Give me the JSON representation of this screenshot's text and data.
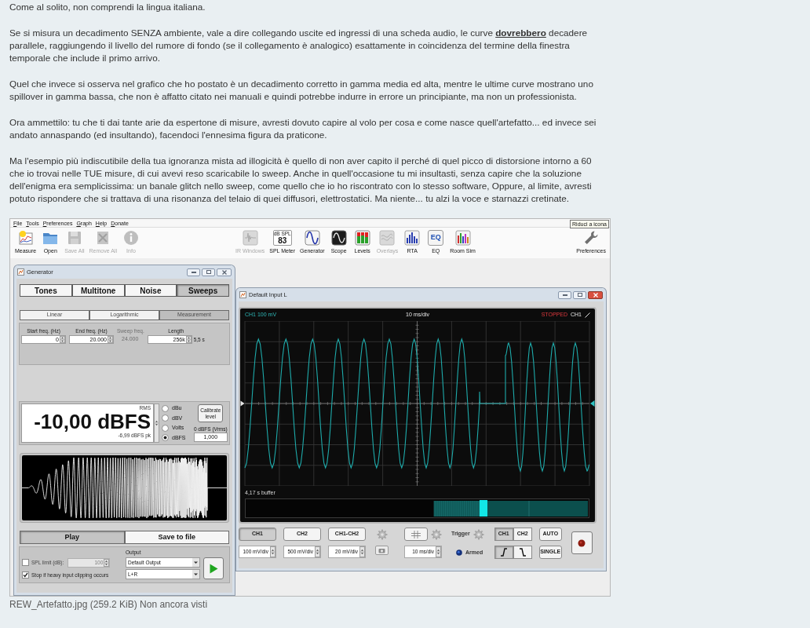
{
  "post": {
    "paragraphs": [
      "Come al solito, non comprendi la lingua italiana.",
      "Se si misura un decadimento SENZA ambiente, vale a dire collegando uscite ed ingressi di una scheda audio, le curve **dovrebbero** decadere parallele, raggiungendo il livello del rumore di fondo (se il collegamento è analogico) esattamente in coincidenza del termine della finestra temporale che include il primo arrivo.",
      "Quel che invece si osserva nel grafico che ho postato è un decadimento corretto in gamma media ed alta, mentre le ultime curve mostrano uno spillover in gamma bassa, che non è affatto citato nei manuali e quindi potrebbe indurre in errore un principiante, ma non un professionista.",
      "Ora ammettilo: tu che ti dai tante arie da espertone di misure, avresti dovuto capire al volo per cosa e come nasce quell'artefatto... ed invece sei andato annaspando (ed insultando), facendoci l'ennesima figura da praticone.",
      "Ma l'esempio più indiscutibile della tua ignoranza mista ad illogicità è quello di non aver capito il perché di quel picco di distorsione intorno a 60 che io trovai nelle TUE misure, di cui avevi reso scaricabile lo sweep. Anche in quell'occasione tu mi insultasti, senza capire che la soluzione dell'enigma era semplicissima: un banale glitch nello sweep, come quello che io ho riscontrato con lo stesso software, Oppure, al limite, avresti potuto rispondere che si trattava di una risonanza del telaio di quei diffusori, elettrostatici. Ma niente... tu alzi la voce e starnazzi cretinate."
    ]
  },
  "attachment": {
    "screenshot": {
      "menu": [
        "File",
        "Tools",
        "Preferences",
        "Graph",
        "Help",
        "Donate"
      ],
      "tooltip": "Riduci a icona",
      "toolbar": {
        "left": [
          {
            "label": "Measure",
            "kind": "measure",
            "disabled": false
          },
          {
            "label": "Open",
            "kind": "open",
            "disabled": false
          },
          {
            "label": "Save All",
            "kind": "save",
            "disabled": true
          },
          {
            "label": "Remove All",
            "kind": "remove",
            "disabled": true
          },
          {
            "label": "Info",
            "kind": "info",
            "disabled": true
          }
        ],
        "center": [
          {
            "label": "IR Windows",
            "kind": "impulse",
            "disabled": true
          },
          {
            "label": "SPL Meter",
            "kind": "meter",
            "disabled": false,
            "unit": "dB SPL",
            "reading": "83"
          },
          {
            "label": "Generator",
            "kind": "generator",
            "disabled": false
          },
          {
            "label": "Scope",
            "kind": "scope",
            "disabled": false
          },
          {
            "label": "Levels",
            "kind": "levels",
            "disabled": false
          },
          {
            "label": "Overlays",
            "kind": "overlays",
            "disabled": true
          },
          {
            "label": "RTA",
            "kind": "rta",
            "disabled": false
          },
          {
            "label": "EQ",
            "kind": "eq",
            "disabled": false,
            "mark": "EQ"
          },
          {
            "label": "Room Sim",
            "kind": "roomsim",
            "disabled": false
          }
        ],
        "right": [
          {
            "label": "Preferences",
            "kind": "preferences",
            "disabled": false
          }
        ]
      },
      "generator": {
        "title": "Generator",
        "active": false,
        "tabs": [
          {
            "label": "Tones",
            "selected": false
          },
          {
            "label": "Multitone",
            "selected": false
          },
          {
            "label": "Noise",
            "selected": false
          },
          {
            "label": "Sweeps",
            "selected": true
          }
        ],
        "sweep_types": [
          {
            "label": "Linear",
            "selected": false
          },
          {
            "label": "Logarithmic",
            "selected": false
          },
          {
            "label": "Measurement",
            "selected": true
          }
        ],
        "fields": [
          {
            "kind": "spinner",
            "label": "Start freq. (Hz)",
            "value": "0",
            "disabled": false
          },
          {
            "kind": "spinner",
            "label": "End freq. (Hz)",
            "value": "20.000",
            "disabled": false
          },
          {
            "kind": "readout",
            "label": "Sweep freq.",
            "value": "24.000",
            "disabled": true
          },
          {
            "kind": "spinner",
            "label": "Length",
            "value": "256k",
            "note": "5,5 s",
            "disabled": false
          }
        ],
        "level": {
          "scale": "RMS",
          "value": "-10,00 dBFS",
          "peak": "-6,99 dBFS pk",
          "units": [
            {
              "label": "dBu",
              "selected": false
            },
            {
              "label": "dBV",
              "selected": false
            },
            {
              "label": "Volts",
              "selected": false
            },
            {
              "label": "dBFS",
              "selected": true
            }
          ],
          "calibrate": "Calibrate level",
          "reference_label": "0 dBFS (Vrms)",
          "reference_value": "1,000"
        },
        "actions": [
          {
            "label": "Play",
            "selected": true
          },
          {
            "label": "Save to file",
            "selected": false
          }
        ],
        "spl_limit": {
          "label": "SPL limit (dB):",
          "checked": false,
          "value": "100"
        },
        "stop_on_clipping": {
          "label": "Stop if heavy input clipping occurs",
          "checked": true
        },
        "output": {
          "label": "Output",
          "device": "Default Output",
          "channels": "L+R"
        }
      },
      "scope": {
        "title": "Default Input L",
        "active": true,
        "display": {
          "scale": "CH1 100 mV",
          "timebase": "10 ms/div",
          "status": "STOPPED",
          "trigger_source": "CH1",
          "buffer": "4,17 s buffer"
        },
        "channels": [
          {
            "label": "CH1",
            "selected": true,
            "scale": "100 mV/div"
          },
          {
            "label": "CH2",
            "selected": false,
            "scale": "500 mV/div"
          },
          {
            "label": "CH1-CH2",
            "selected": false,
            "scale": "20 mV/div"
          }
        ],
        "timebase": "10 ms/div",
        "trigger": {
          "label": "Trigger",
          "sources": [
            {
              "label": "CH1",
              "selected": true
            },
            {
              "label": "CH2",
              "selected": false
            }
          ],
          "slopes": [
            {
              "kind": "rising",
              "selected": true
            },
            {
              "kind": "falling",
              "selected": false
            }
          ],
          "status": "Armed"
        },
        "modes": [
          "AUTO",
          "SINGLE"
        ]
      }
    },
    "caption": "REW_Artefatto.jpg (259.2 KiB) Non ancora visti"
  }
}
